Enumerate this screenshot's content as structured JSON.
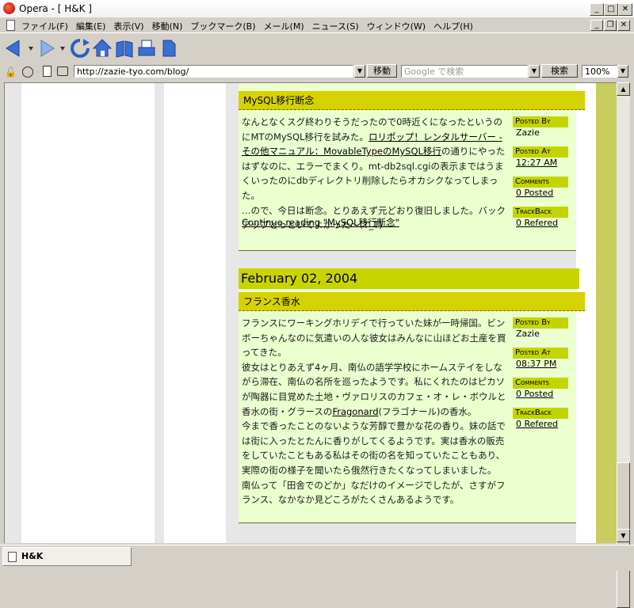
{
  "window": {
    "title": "Opera - [ H&K ]"
  },
  "menu": [
    "ファイル(F)",
    "編集(E)",
    "表示(V)",
    "移動(N)",
    "ブックマーク(B)",
    "メール(M)",
    "ニュース(S)",
    "ウィンドウ(W)",
    "ヘルプ(H)"
  ],
  "address": {
    "url": "http://zazie-tyo.com/blog/",
    "go_label": "移動",
    "search_placeholder": "Google で検索",
    "search_label": "検索",
    "zoom": "100%"
  },
  "entries": [
    {
      "title": "MySQL移行断念",
      "body": [
        {
          "t": "なんとなくスグ終わりそうだったので0時近くになったというのにMTのMySQL移行を試みた。"
        },
        {
          "t": "ロリポップ！レンタルサーバー - その他マニュアル：MovableTypeのMySQL移行",
          "link": true
        },
        {
          "t": "の通りにやったはずなのに、エラーでまくり。mt-db2sql.cgiの表示まではうまくいったのにdbディレクトリ削除したらオカシクなってしまった。"
        },
        {
          "t": "…ので、今日は断念。とりあえず元どおり復旧しました。バックアップとっといてよかった〜(T_T)"
        }
      ],
      "continue_text": "Continue reading \"MySQL移行断念\"",
      "posted_by_label": "Posted By",
      "posted_by": "Zazie",
      "posted_at_label": "Posted At",
      "posted_at": "12:27 AM",
      "comments_label": "Comments",
      "comments": "0 Posted",
      "trackback_label": "TrackBack",
      "trackback": "0 Refered"
    },
    {
      "date": "February 02, 2004",
      "title": "フランス香水",
      "body": [
        {
          "t": "フランスにワーキングホリデイで行っていた妹が一時帰国。ビンボーちゃんなのに気遣いの人な彼女はみんなに山ほどお土産を買ってきた。"
        },
        {
          "t": "彼女はとりあえず4ヶ月、南仏の語学学校にホームステイをしながら滞在、南仏の名所を巡ったようです。私にくれたのはピカソが陶器に目覚めた土地・ヴァロリスのカフェ・オ・レ・ボウルと香水の街・グラースの"
        },
        {
          "t": "Fragonard",
          "link": true
        },
        {
          "t": "(フラゴナール)の香水。"
        },
        {
          "t": "今まで香ったことのないような芳醇で豊かな花の香り。妹の話では街に入ったとたんに香りがしてくるようです。実は香水の販売をしていたこともある私はその街の名を知っていたこともあり、実際の街の様子を聞いたら俄然行きたくなってしまいました。"
        },
        {
          "t": "南仏って「田舎でのどか」なだけのイメージでしたが、さすがフランス、なかなか見どころがたくさんあるようです。"
        }
      ],
      "posted_by_label": "Posted By",
      "posted_by": "Zazie",
      "posted_at_label": "Posted At",
      "posted_at": "08:37 PM",
      "comments_label": "Comments",
      "comments": "0 Posted",
      "trackback_label": "TrackBack",
      "trackback": "0 Refered"
    }
  ],
  "status": {
    "tab_title": "H&K"
  }
}
